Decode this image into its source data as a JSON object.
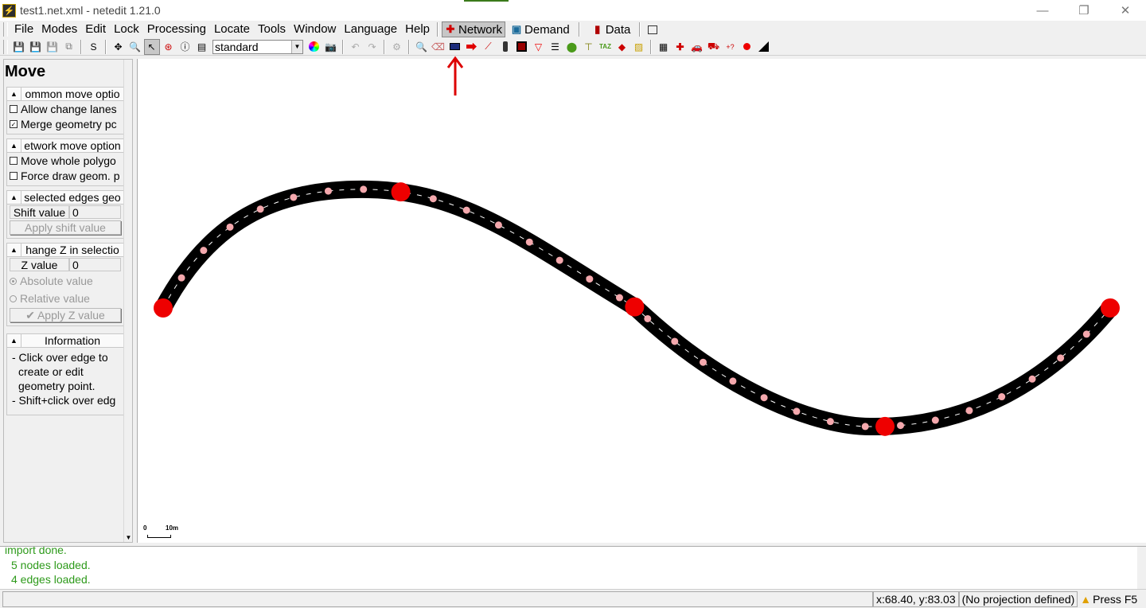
{
  "window": {
    "title": "test1.net.xml - netedit 1.21.0",
    "controls": {
      "minimize": "—",
      "restore": "❐",
      "close": "✕"
    }
  },
  "menubar": {
    "items": [
      "File",
      "Modes",
      "Edit",
      "Lock",
      "Processing",
      "Locate",
      "Tools",
      "Window",
      "Language",
      "Help"
    ],
    "supermodes": [
      {
        "label": "Network",
        "active": true
      },
      {
        "label": "Demand",
        "active": false
      },
      {
        "label": "Data",
        "active": false
      }
    ]
  },
  "toolbar": {
    "s_label": "S",
    "scheme_value": "standard"
  },
  "leftpanel": {
    "title": "Move",
    "common": {
      "header": "ommon move optio",
      "allow_change_lanes": "Allow change lanes",
      "merge_geometry": "Merge geometry pc"
    },
    "network": {
      "header": "etwork move option",
      "move_whole": "Move whole polygo",
      "force_draw": "Force draw geom. p"
    },
    "shift": {
      "header": "selected edges geo",
      "label": "Shift value",
      "value": "0",
      "button": "Apply shift value"
    },
    "changez": {
      "header": "hange Z in selectio",
      "label": "Z value",
      "value": "0",
      "absolute": "Absolute value",
      "relative": "Relative value",
      "button": "Apply Z value"
    },
    "info": {
      "header": "Information",
      "line1": "- Click over edge to",
      "line2": "create or edit",
      "line3": "geometry point.",
      "line4": "- Shift+click over edg"
    }
  },
  "canvas": {
    "scale_start": "0",
    "scale_end": "10m",
    "colors": {
      "road": "#000000",
      "junction": "#ee0000",
      "geometry_point": "#f4a8ad"
    }
  },
  "messages": {
    "line1": "import done.",
    "line2": "5 nodes loaded.",
    "line3": "4 edges loaded."
  },
  "statusbar": {
    "coords": "x:68.40, y:83.03",
    "projection": "(No projection defined)",
    "press": "Press F5"
  }
}
